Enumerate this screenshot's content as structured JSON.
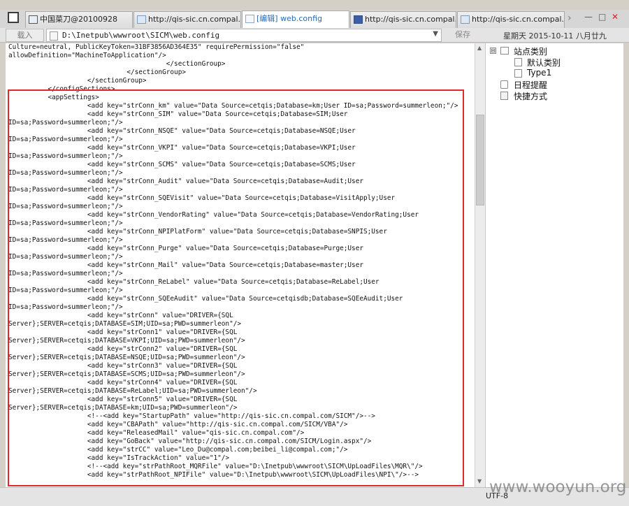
{
  "tabs": [
    {
      "label": "中国菜刀@20100928",
      "active": false
    },
    {
      "label": "http://qis-sic.cn.compal....",
      "active": false
    },
    {
      "label": "[编辑] web.config",
      "active": true
    },
    {
      "label": "http://qis-sic.cn.compal....",
      "active": false
    },
    {
      "label": "http://qis-sic.cn.compal....",
      "active": false
    }
  ],
  "window_controls": {
    "more": "›",
    "minimize": "—",
    "maximize": "□",
    "close": "✕"
  },
  "toolbar": {
    "load_label": "载入",
    "path_value": "D:\\Inetpub\\wwwroot\\SICM\\web.config",
    "save_label": "保存",
    "datetime": "星期天 2015-10-11 八月廿九"
  },
  "editor": {
    "lines": [
      "Culture=neutral, PublicKeyToken=31BF3856AD364E35\" requirePermission=\"false\"",
      "allowDefinition=\"MachineToApplication\"/>",
      "                                        </sectionGroup>",
      "                              </sectionGroup>",
      "                    </sectionGroup>",
      "          </configSections>",
      "          <appSettings>",
      "                    <add key=\"strConn_km\" value=\"Data Source=cetqis;Database=km;User ID=sa;Password=summerleon;\"/>",
      "                    <add key=\"strConn_SIM\" value=\"Data Source=cetqis;Database=SIM;User",
      "ID=sa;Password=summerleon;\"/>",
      "                    <add key=\"strConn_NSQE\" value=\"Data Source=cetqis;Database=NSQE;User",
      "ID=sa;Password=summerleon;\"/>",
      "                    <add key=\"strConn_VKPI\" value=\"Data Source=cetqis;Database=VKPI;User",
      "ID=sa;Password=summerleon;\"/>",
      "                    <add key=\"strConn_SCMS\" value=\"Data Source=cetqis;Database=SCMS;User",
      "ID=sa;Password=summerleon;\"/>",
      "                    <add key=\"strConn_Audit\" value=\"Data Source=cetqis;Database=Audit;User",
      "ID=sa;Password=summerleon;\"/>",
      "                    <add key=\"strConn_SQEVisit\" value=\"Data Source=cetqis;Database=VisitApply;User",
      "ID=sa;Password=summerleon;\"/>",
      "                    <add key=\"strConn_VendorRating\" value=\"Data Source=cetqis;Database=VendorRating;User",
      "ID=sa;Password=summerleon;\"/>",
      "                    <add key=\"strConn_NPIPlatForm\" value=\"Data Source=cetqis;Database=SNPIS;User",
      "ID=sa;Password=summerleon;\"/>",
      "                    <add key=\"strConn_Purge\" value=\"Data Source=cetqis;Database=Purge;User",
      "ID=sa;Password=summerleon;\"/>",
      "                    <add key=\"strConn_Mail\" value=\"Data Source=cetqis;Database=master;User",
      "ID=sa;Password=summerleon;\"/>",
      "                    <add key=\"strConn_ReLabel\" value=\"Data Source=cetqis;Database=ReLabel;User",
      "ID=sa;Password=summerleon;\"/>",
      "                    <add key=\"strConn_SQEeAudit\" value=\"Data Source=cetqisdb;Database=SQEeAudit;User",
      "ID=sa;Password=summerleon;\"/>",
      "                    <add key=\"strConn\" value=\"DRIVER={SQL",
      "Server};SERVER=cetqis;DATABASE=SIM;UID=sa;PWD=summerleon\"/>",
      "                    <add key=\"strConn1\" value=\"DRIVER={SQL",
      "Server};SERVER=cetqis;DATABASE=VKPI;UID=sa;PWD=summerleon\"/>",
      "                    <add key=\"strConn2\" value=\"DRIVER={SQL",
      "Server};SERVER=cetqis;DATABASE=NSQE;UID=sa;PWD=summerleon\"/>",
      "                    <add key=\"strConn3\" value=\"DRIVER={SQL",
      "Server};SERVER=cetqis;DATABASE=SCMS;UID=sa;PWD=summerleon\"/>",
      "                    <add key=\"strConn4\" value=\"DRIVER={SQL",
      "Server};SERVER=cetqis;DATABASE=ReLabel;UID=sa;PWD=summerleon\"/>",
      "                    <add key=\"strConn5\" value=\"DRIVER={SQL",
      "Server};SERVER=cetqis;DATABASE=km;UID=sa;PWD=summerleon\"/>",
      "                    <!--<add key=\"StartupPath\" value=\"http://qis-sic.cn.compal.com/SICM\"/>-->",
      "                    <add key=\"CBAPath\" value=\"http://qis-sic.cn.compal.com/SICM/VBA\"/>",
      "                    <add key=\"ReleasedMail\" value=\"qis-sic.cn.compal.com\"/>",
      "                    <add key=\"GoBack\" value=\"http://qis-sic.cn.compal.com/SICM/Login.aspx\"/>",
      "                    <add key=\"strCC\" value=\"Leo_Du@compal.com;beibei_li@compal.com;\"/>",
      "                    <add key=\"IsTrackAction\" value=\"1\"/>",
      "                    <!--<add key=\"strPathRoot_MQRFile\" value=\"D:\\Inetpub\\wwwroot\\SICM\\UpLoadFiles\\MQR\\\"/>",
      "                    <add key=\"strPathRoot_NPIFile\" value=\"D:\\Inetpub\\wwwroot\\SICM\\UpLoadFiles\\NPI\\\"/>-->"
    ]
  },
  "tree": {
    "root": {
      "label": "站点类别",
      "toggle": "⊟"
    },
    "children": [
      "默认类别",
      "Type1"
    ],
    "nodes": [
      {
        "label": "日程提醒",
        "icon": "calendar-icon"
      },
      {
        "label": "快捷方式",
        "icon": "shortcut-icon"
      }
    ]
  },
  "status": {
    "encoding": "UTF-8"
  },
  "watermark": "www.wooyun.org",
  "colors": {
    "highlight": "#e02a2a",
    "active_tab_text": "#2a6ab0"
  }
}
